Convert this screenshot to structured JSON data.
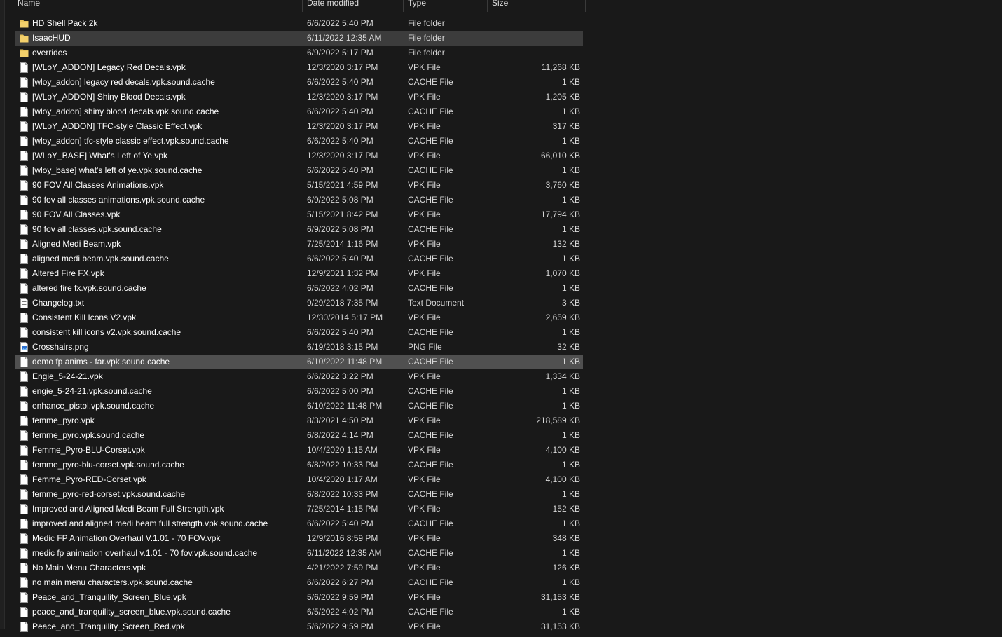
{
  "columns": {
    "name": "Name",
    "date": "Date modified",
    "type": "Type",
    "size": "Size"
  },
  "colors": {
    "background": "#191919",
    "selected_row": "#505050",
    "folder_icon": "#e8c35a",
    "file_icon": "#ffffff"
  },
  "files": [
    {
      "name": "HD Shell Pack 2k",
      "date": "6/6/2022 5:40 PM",
      "type": "File folder",
      "size": "",
      "icon": "folder-icon"
    },
    {
      "name": "IsaacHUD",
      "date": "6/11/2022 12:35 AM",
      "type": "File folder",
      "size": "",
      "icon": "folder-icon",
      "state": "hover"
    },
    {
      "name": "overrides",
      "date": "6/9/2022 5:17 PM",
      "type": "File folder",
      "size": "",
      "icon": "folder-icon"
    },
    {
      "name": "[WLoY_ADDON] Legacy Red Decals.vpk",
      "date": "12/3/2020 3:17 PM",
      "type": "VPK File",
      "size": "11,268 KB",
      "icon": "file-icon"
    },
    {
      "name": "[wloy_addon] legacy red decals.vpk.sound.cache",
      "date": "6/6/2022 5:40 PM",
      "type": "CACHE File",
      "size": "1 KB",
      "icon": "file-icon"
    },
    {
      "name": "[WLoY_ADDON] Shiny Blood Decals.vpk",
      "date": "12/3/2020 3:17 PM",
      "type": "VPK File",
      "size": "1,205 KB",
      "icon": "file-icon"
    },
    {
      "name": "[wloy_addon] shiny blood decals.vpk.sound.cache",
      "date": "6/6/2022 5:40 PM",
      "type": "CACHE File",
      "size": "1 KB",
      "icon": "file-icon"
    },
    {
      "name": "[WLoY_ADDON] TFC-style Classic Effect.vpk",
      "date": "12/3/2020 3:17 PM",
      "type": "VPK File",
      "size": "317 KB",
      "icon": "file-icon"
    },
    {
      "name": "[wloy_addon] tfc-style classic effect.vpk.sound.cache",
      "date": "6/6/2022 5:40 PM",
      "type": "CACHE File",
      "size": "1 KB",
      "icon": "file-icon"
    },
    {
      "name": "[WLoY_BASE] What's Left of Ye.vpk",
      "date": "12/3/2020 3:17 PM",
      "type": "VPK File",
      "size": "66,010 KB",
      "icon": "file-icon"
    },
    {
      "name": "[wloy_base] what's left of ye.vpk.sound.cache",
      "date": "6/6/2022 5:40 PM",
      "type": "CACHE File",
      "size": "1 KB",
      "icon": "file-icon"
    },
    {
      "name": "90 FOV All Classes Animations.vpk",
      "date": "5/15/2021 4:59 PM",
      "type": "VPK File",
      "size": "3,760 KB",
      "icon": "file-icon"
    },
    {
      "name": "90 fov all classes animations.vpk.sound.cache",
      "date": "6/9/2022 5:08 PM",
      "type": "CACHE File",
      "size": "1 KB",
      "icon": "file-icon"
    },
    {
      "name": "90 FOV All Classes.vpk",
      "date": "5/15/2021 8:42 PM",
      "type": "VPK File",
      "size": "17,794 KB",
      "icon": "file-icon"
    },
    {
      "name": "90 fov all classes.vpk.sound.cache",
      "date": "6/9/2022 5:08 PM",
      "type": "CACHE File",
      "size": "1 KB",
      "icon": "file-icon"
    },
    {
      "name": "Aligned Medi Beam.vpk",
      "date": "7/25/2014 1:16 PM",
      "type": "VPK File",
      "size": "132 KB",
      "icon": "file-icon"
    },
    {
      "name": "aligned medi beam.vpk.sound.cache",
      "date": "6/6/2022 5:40 PM",
      "type": "CACHE File",
      "size": "1 KB",
      "icon": "file-icon"
    },
    {
      "name": "Altered Fire FX.vpk",
      "date": "12/9/2021 1:32 PM",
      "type": "VPK File",
      "size": "1,070 KB",
      "icon": "file-icon"
    },
    {
      "name": "altered fire fx.vpk.sound.cache",
      "date": "6/5/2022 4:02 PM",
      "type": "CACHE File",
      "size": "1 KB",
      "icon": "file-icon"
    },
    {
      "name": "Changelog.txt",
      "date": "9/29/2018 7:35 PM",
      "type": "Text Document",
      "size": "3 KB",
      "icon": "text-file-icon"
    },
    {
      "name": "Consistent Kill Icons V2.vpk",
      "date": "12/30/2014 5:17 PM",
      "type": "VPK File",
      "size": "2,659 KB",
      "icon": "file-icon"
    },
    {
      "name": "consistent kill icons v2.vpk.sound.cache",
      "date": "6/6/2022 5:40 PM",
      "type": "CACHE File",
      "size": "1 KB",
      "icon": "file-icon"
    },
    {
      "name": "Crosshairs.png",
      "date": "6/19/2018 3:15 PM",
      "type": "PNG File",
      "size": "32 KB",
      "icon": "image-file-icon"
    },
    {
      "name": "demo fp anims - far.vpk.sound.cache",
      "date": "6/10/2022 11:48 PM",
      "type": "CACHE File",
      "size": "1 KB",
      "icon": "file-icon",
      "state": "selected"
    },
    {
      "name": "Engie_5-24-21.vpk",
      "date": "6/6/2022 3:22 PM",
      "type": "VPK File",
      "size": "1,334 KB",
      "icon": "file-icon"
    },
    {
      "name": "engie_5-24-21.vpk.sound.cache",
      "date": "6/6/2022 5:00 PM",
      "type": "CACHE File",
      "size": "1 KB",
      "icon": "file-icon"
    },
    {
      "name": "enhance_pistol.vpk.sound.cache",
      "date": "6/10/2022 11:48 PM",
      "type": "CACHE File",
      "size": "1 KB",
      "icon": "file-icon"
    },
    {
      "name": "femme_pyro.vpk",
      "date": "8/3/2021 4:50 PM",
      "type": "VPK File",
      "size": "218,589 KB",
      "icon": "file-icon"
    },
    {
      "name": "femme_pyro.vpk.sound.cache",
      "date": "6/8/2022 4:14 PM",
      "type": "CACHE File",
      "size": "1 KB",
      "icon": "file-icon"
    },
    {
      "name": "Femme_Pyro-BLU-Corset.vpk",
      "date": "10/4/2020 1:15 AM",
      "type": "VPK File",
      "size": "4,100 KB",
      "icon": "file-icon"
    },
    {
      "name": "femme_pyro-blu-corset.vpk.sound.cache",
      "date": "6/8/2022 10:33 PM",
      "type": "CACHE File",
      "size": "1 KB",
      "icon": "file-icon"
    },
    {
      "name": "Femme_Pyro-RED-Corset.vpk",
      "date": "10/4/2020 1:17 AM",
      "type": "VPK File",
      "size": "4,100 KB",
      "icon": "file-icon"
    },
    {
      "name": "femme_pyro-red-corset.vpk.sound.cache",
      "date": "6/8/2022 10:33 PM",
      "type": "CACHE File",
      "size": "1 KB",
      "icon": "file-icon"
    },
    {
      "name": "Improved and Aligned Medi Beam Full Strength.vpk",
      "date": "7/25/2014 1:15 PM",
      "type": "VPK File",
      "size": "152 KB",
      "icon": "file-icon"
    },
    {
      "name": "improved and aligned medi beam full strength.vpk.sound.cache",
      "date": "6/6/2022 5:40 PM",
      "type": "CACHE File",
      "size": "1 KB",
      "icon": "file-icon"
    },
    {
      "name": "Medic FP Animation Overhaul V.1.01 - 70 FOV.vpk",
      "date": "12/9/2016 8:59 PM",
      "type": "VPK File",
      "size": "348 KB",
      "icon": "file-icon"
    },
    {
      "name": "medic fp animation overhaul v.1.01 - 70 fov.vpk.sound.cache",
      "date": "6/11/2022 12:35 AM",
      "type": "CACHE File",
      "size": "1 KB",
      "icon": "file-icon"
    },
    {
      "name": "No Main Menu Characters.vpk",
      "date": "4/21/2022 7:59 PM",
      "type": "VPK File",
      "size": "126 KB",
      "icon": "file-icon"
    },
    {
      "name": "no main menu characters.vpk.sound.cache",
      "date": "6/6/2022 6:27 PM",
      "type": "CACHE File",
      "size": "1 KB",
      "icon": "file-icon"
    },
    {
      "name": "Peace_and_Tranquility_Screen_Blue.vpk",
      "date": "5/6/2022 9:59 PM",
      "type": "VPK File",
      "size": "31,153 KB",
      "icon": "file-icon"
    },
    {
      "name": "peace_and_tranquility_screen_blue.vpk.sound.cache",
      "date": "6/5/2022 4:02 PM",
      "type": "CACHE File",
      "size": "1 KB",
      "icon": "file-icon"
    },
    {
      "name": "Peace_and_Tranquility_Screen_Red.vpk",
      "date": "5/6/2022 9:59 PM",
      "type": "VPK File",
      "size": "31,153 KB",
      "icon": "file-icon"
    }
  ]
}
